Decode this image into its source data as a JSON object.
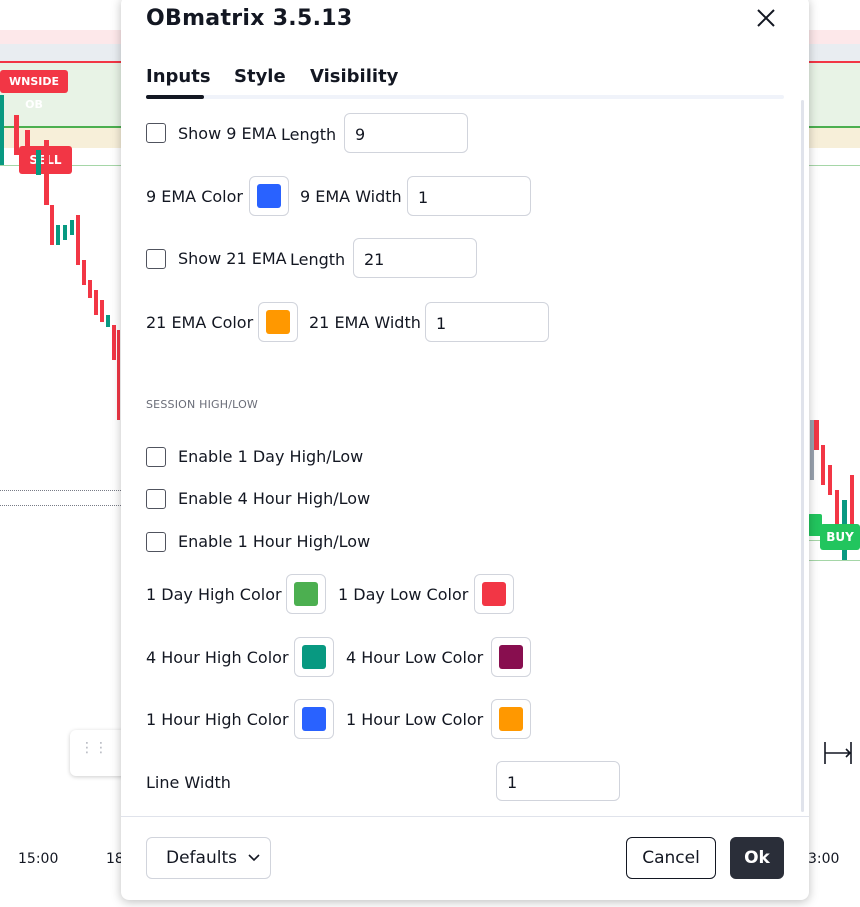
{
  "chart": {
    "ob_label": "WNSIDE OB",
    "sell_label": "SELL",
    "buy_label": "BUY",
    "x_labels": [
      "15:00",
      "18",
      "3:00"
    ],
    "colors": {
      "up": "#089981",
      "down": "#f23645",
      "buy": "#22c55e"
    }
  },
  "dialog": {
    "title": "OBmatrix 3.5.13",
    "tabs": [
      {
        "label": "Inputs",
        "active": true
      },
      {
        "label": "Style",
        "active": false
      },
      {
        "label": "Visibility",
        "active": false
      }
    ],
    "inputs": {
      "show9": {
        "label": "Show 9 EMA",
        "checked": false,
        "length_label": "Length",
        "length": "9"
      },
      "ema9": {
        "color_label": "9 EMA Color",
        "color": "#2962ff",
        "width_label": "9 EMA Width",
        "width": "1"
      },
      "show21": {
        "label": "Show 21 EMA",
        "checked": false,
        "length_label": "Length",
        "length": "21"
      },
      "ema21": {
        "color_label": "21 EMA Color",
        "color": "#ff9800",
        "width_label": "21 EMA Width",
        "width": "1"
      },
      "section_session": "SESSION HIGH/LOW",
      "enable_1d": {
        "label": "Enable 1 Day High/Low",
        "checked": false
      },
      "enable_4h": {
        "label": "Enable 4 Hour High/Low",
        "checked": false
      },
      "enable_1h": {
        "label": "Enable 1 Hour High/Low",
        "checked": false
      },
      "day": {
        "high_label": "1 Day High Color",
        "high_color": "#4caf50",
        "low_label": "1 Day Low Color",
        "low_color": "#f23645"
      },
      "h4": {
        "high_label": "4 Hour High Color",
        "high_color": "#089981",
        "low_label": "4 Hour Low Color",
        "low_color": "#880e4f"
      },
      "h1": {
        "high_label": "1 Hour High Color",
        "high_color": "#2962ff",
        "low_label": "1 Hour Low Color",
        "low_color": "#ff9800"
      },
      "line_width": {
        "label": "Line Width",
        "value": "1"
      }
    },
    "footer": {
      "defaults": "Defaults",
      "cancel": "Cancel",
      "ok": "Ok"
    }
  }
}
